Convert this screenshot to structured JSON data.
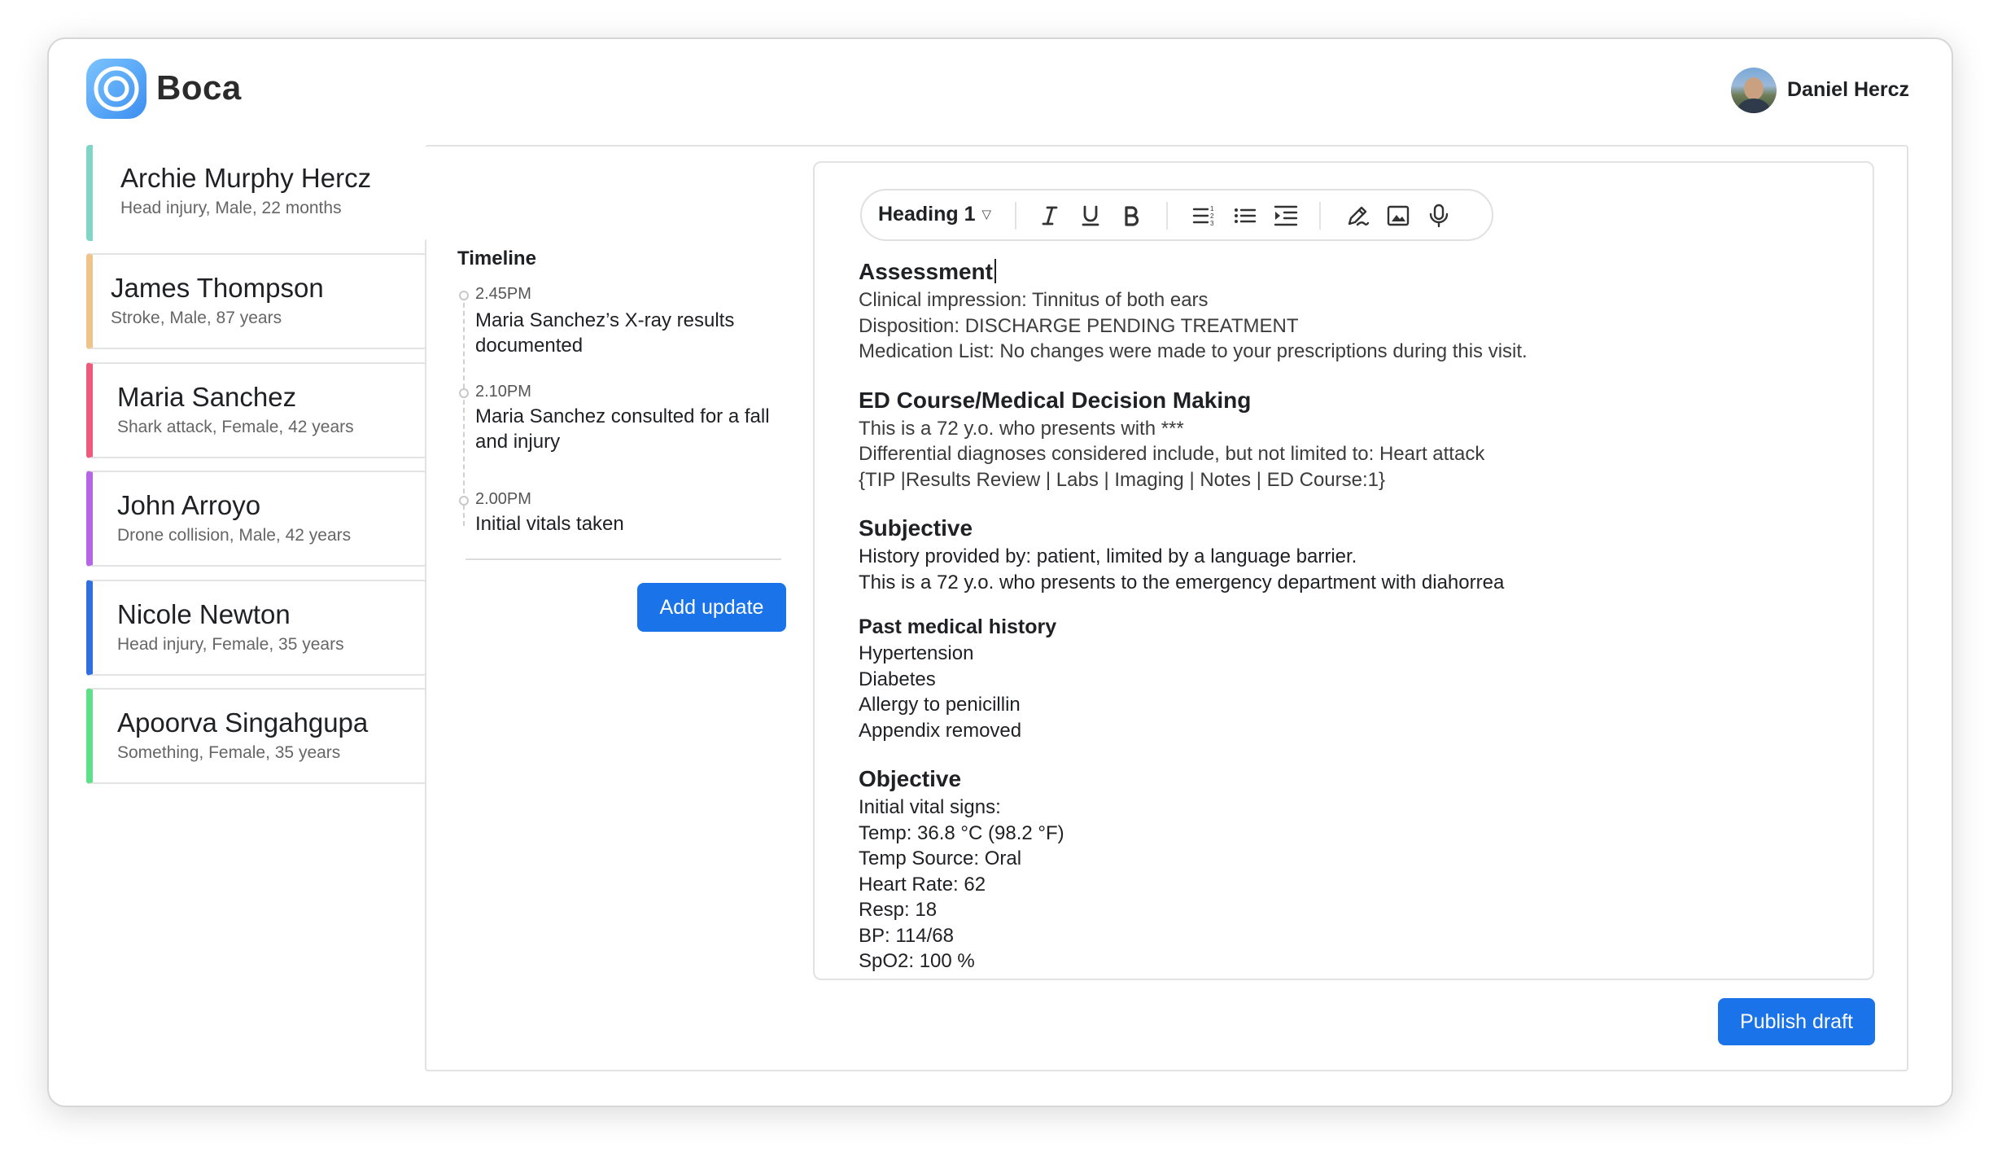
{
  "app": {
    "name": "Boca"
  },
  "user": {
    "name": "Daniel Hercz"
  },
  "patients": [
    {
      "name": "Archie Murphy Hercz",
      "details": "Head injury, Male, 22 months",
      "color": "#7fd6c6"
    },
    {
      "name": "James Thompson",
      "details": "Stroke, Male, 87 years",
      "color": "#f0c38a"
    },
    {
      "name": "Maria Sanchez",
      "details": "Shark attack, Female, 42 years",
      "color": "#ef5a7a"
    },
    {
      "name": "John Arroyo",
      "details": "Drone collision, Male, 42 years",
      "color": "#b565e6"
    },
    {
      "name": "Nicole Newton",
      "details": "Head injury, Female, 35 years",
      "color": "#2f6fe0"
    },
    {
      "name": "Apoorva Singahgupa",
      "details": "Something, Female, 35 years",
      "color": "#5ee08a"
    }
  ],
  "timeline": {
    "title": "Timeline",
    "entries": [
      {
        "time": "2.45PM",
        "text": "Maria Sanchez’s X-ray results documented"
      },
      {
        "time": "2.10PM",
        "text": "Maria Sanchez consulted for a fall and injury"
      },
      {
        "time": "2.00PM",
        "text": "Initial vitals taken"
      }
    ],
    "add_label": "Add update"
  },
  "toolbar": {
    "heading_value": "Heading 1",
    "icons": [
      "italic-icon",
      "underline-icon",
      "bold-icon",
      "numbered-list-icon",
      "bulleted-list-icon",
      "indent-icon",
      "pen-icon",
      "image-icon",
      "microphone-icon"
    ]
  },
  "document": {
    "assessment": {
      "heading": "Assessment",
      "lines": [
        "Clinical impression: Tinnitus of both ears",
        "Disposition:  DISCHARGE PENDING TREATMENT",
        "Medication List: No changes were made to your prescriptions during this visit."
      ]
    },
    "ed_course": {
      "heading": "ED Course/Medical Decision Making",
      "lines": [
        "This is a 72 y.o. who presents with ***",
        "Differential diagnoses considered include, but not limited to: Heart attack",
        "{TIP |Results Review | Labs | Imaging | Notes | ED Course:1}"
      ]
    },
    "subjective": {
      "heading": "Subjective",
      "lines": [
        "History provided by: patient, limited by a language barrier.",
        "This is a 72 y.o. who presents to the emergency department with diahorrea"
      ]
    },
    "past_history": {
      "heading": "Past medical history",
      "lines": [
        "Hypertension",
        "Diabetes",
        "Allergy to penicillin",
        "Appendix removed"
      ]
    },
    "objective": {
      "heading": "Objective",
      "lines": [
        "Initial vital signs:",
        "Temp: 36.8 °C (98.2 °F)",
        "Temp Source: Oral",
        "Heart Rate: 62",
        "Resp: 18",
        "BP: 114/68",
        "SpO2: 100 %"
      ]
    }
  },
  "publish_label": "Publish draft",
  "colors": {
    "primary": "#1a73e8",
    "logo_blue": "#4a9ff5"
  }
}
